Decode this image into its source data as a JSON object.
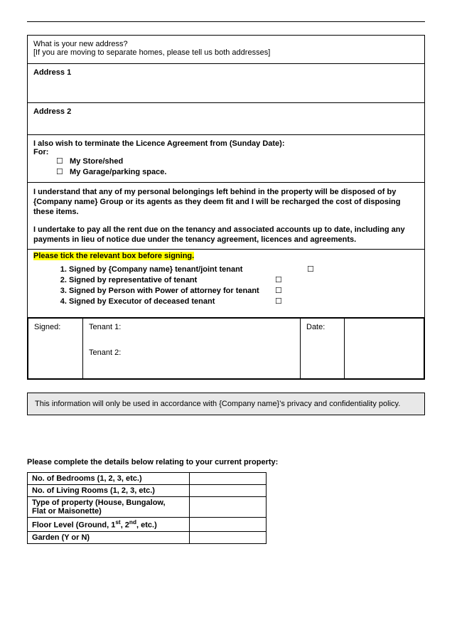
{
  "question": {
    "line1": "What is your new address?",
    "line2": "[If you are moving to separate homes, please tell us both addresses]"
  },
  "address1_label": "Address 1",
  "address2_label": "Address 2",
  "licence": {
    "heading": "I also wish to terminate the Licence Agreement from (Sunday Date):",
    "for_label": "For:",
    "opt1": "My Store/shed",
    "opt2": "My Garage/parking space."
  },
  "disposal_para": "I understand that any of my personal belongings left behind in the property will be disposed of by {Company name} Group or its agents as they deem fit and I will be recharged the cost of disposing these items.",
  "rent_para": "I undertake to pay all the rent due on the tenancy and associated accounts up to date, including any payments in lieu of notice due under the tenancy agreement, licences and agreements.",
  "tick_heading": "Please tick the relevant box before signing.",
  "sign_options": {
    "o1": "Signed by {Company name} tenant/joint tenant",
    "o2": "Signed by representative of tenant",
    "o3": "Signed by Person with Power of attorney for tenant",
    "o4": "Signed by Executor of deceased tenant"
  },
  "sig_labels": {
    "signed": "Signed:",
    "t1": "Tenant 1:",
    "t2": "Tenant 2:",
    "date": "Date:"
  },
  "privacy": "This information will only be used in accordance with {Company name}'s privacy and confidentiality policy.",
  "property_heading": "Please complete the details below relating to your current property",
  "property_rows": {
    "r1": "No. of Bedrooms (1, 2, 3, etc.)",
    "r2": "No. of Living Rooms (1, 2, 3, etc.)",
    "r3a": "Type of property (House, Bungalow,",
    "r3b": "Flat or Maisonette)",
    "r4_pre": "Floor Level (Ground, 1",
    "r4_mid": ", 2",
    "r4_post": ", etc.)",
    "r5": "Garden (Y or N)"
  },
  "checkbox_glyph": "☐"
}
